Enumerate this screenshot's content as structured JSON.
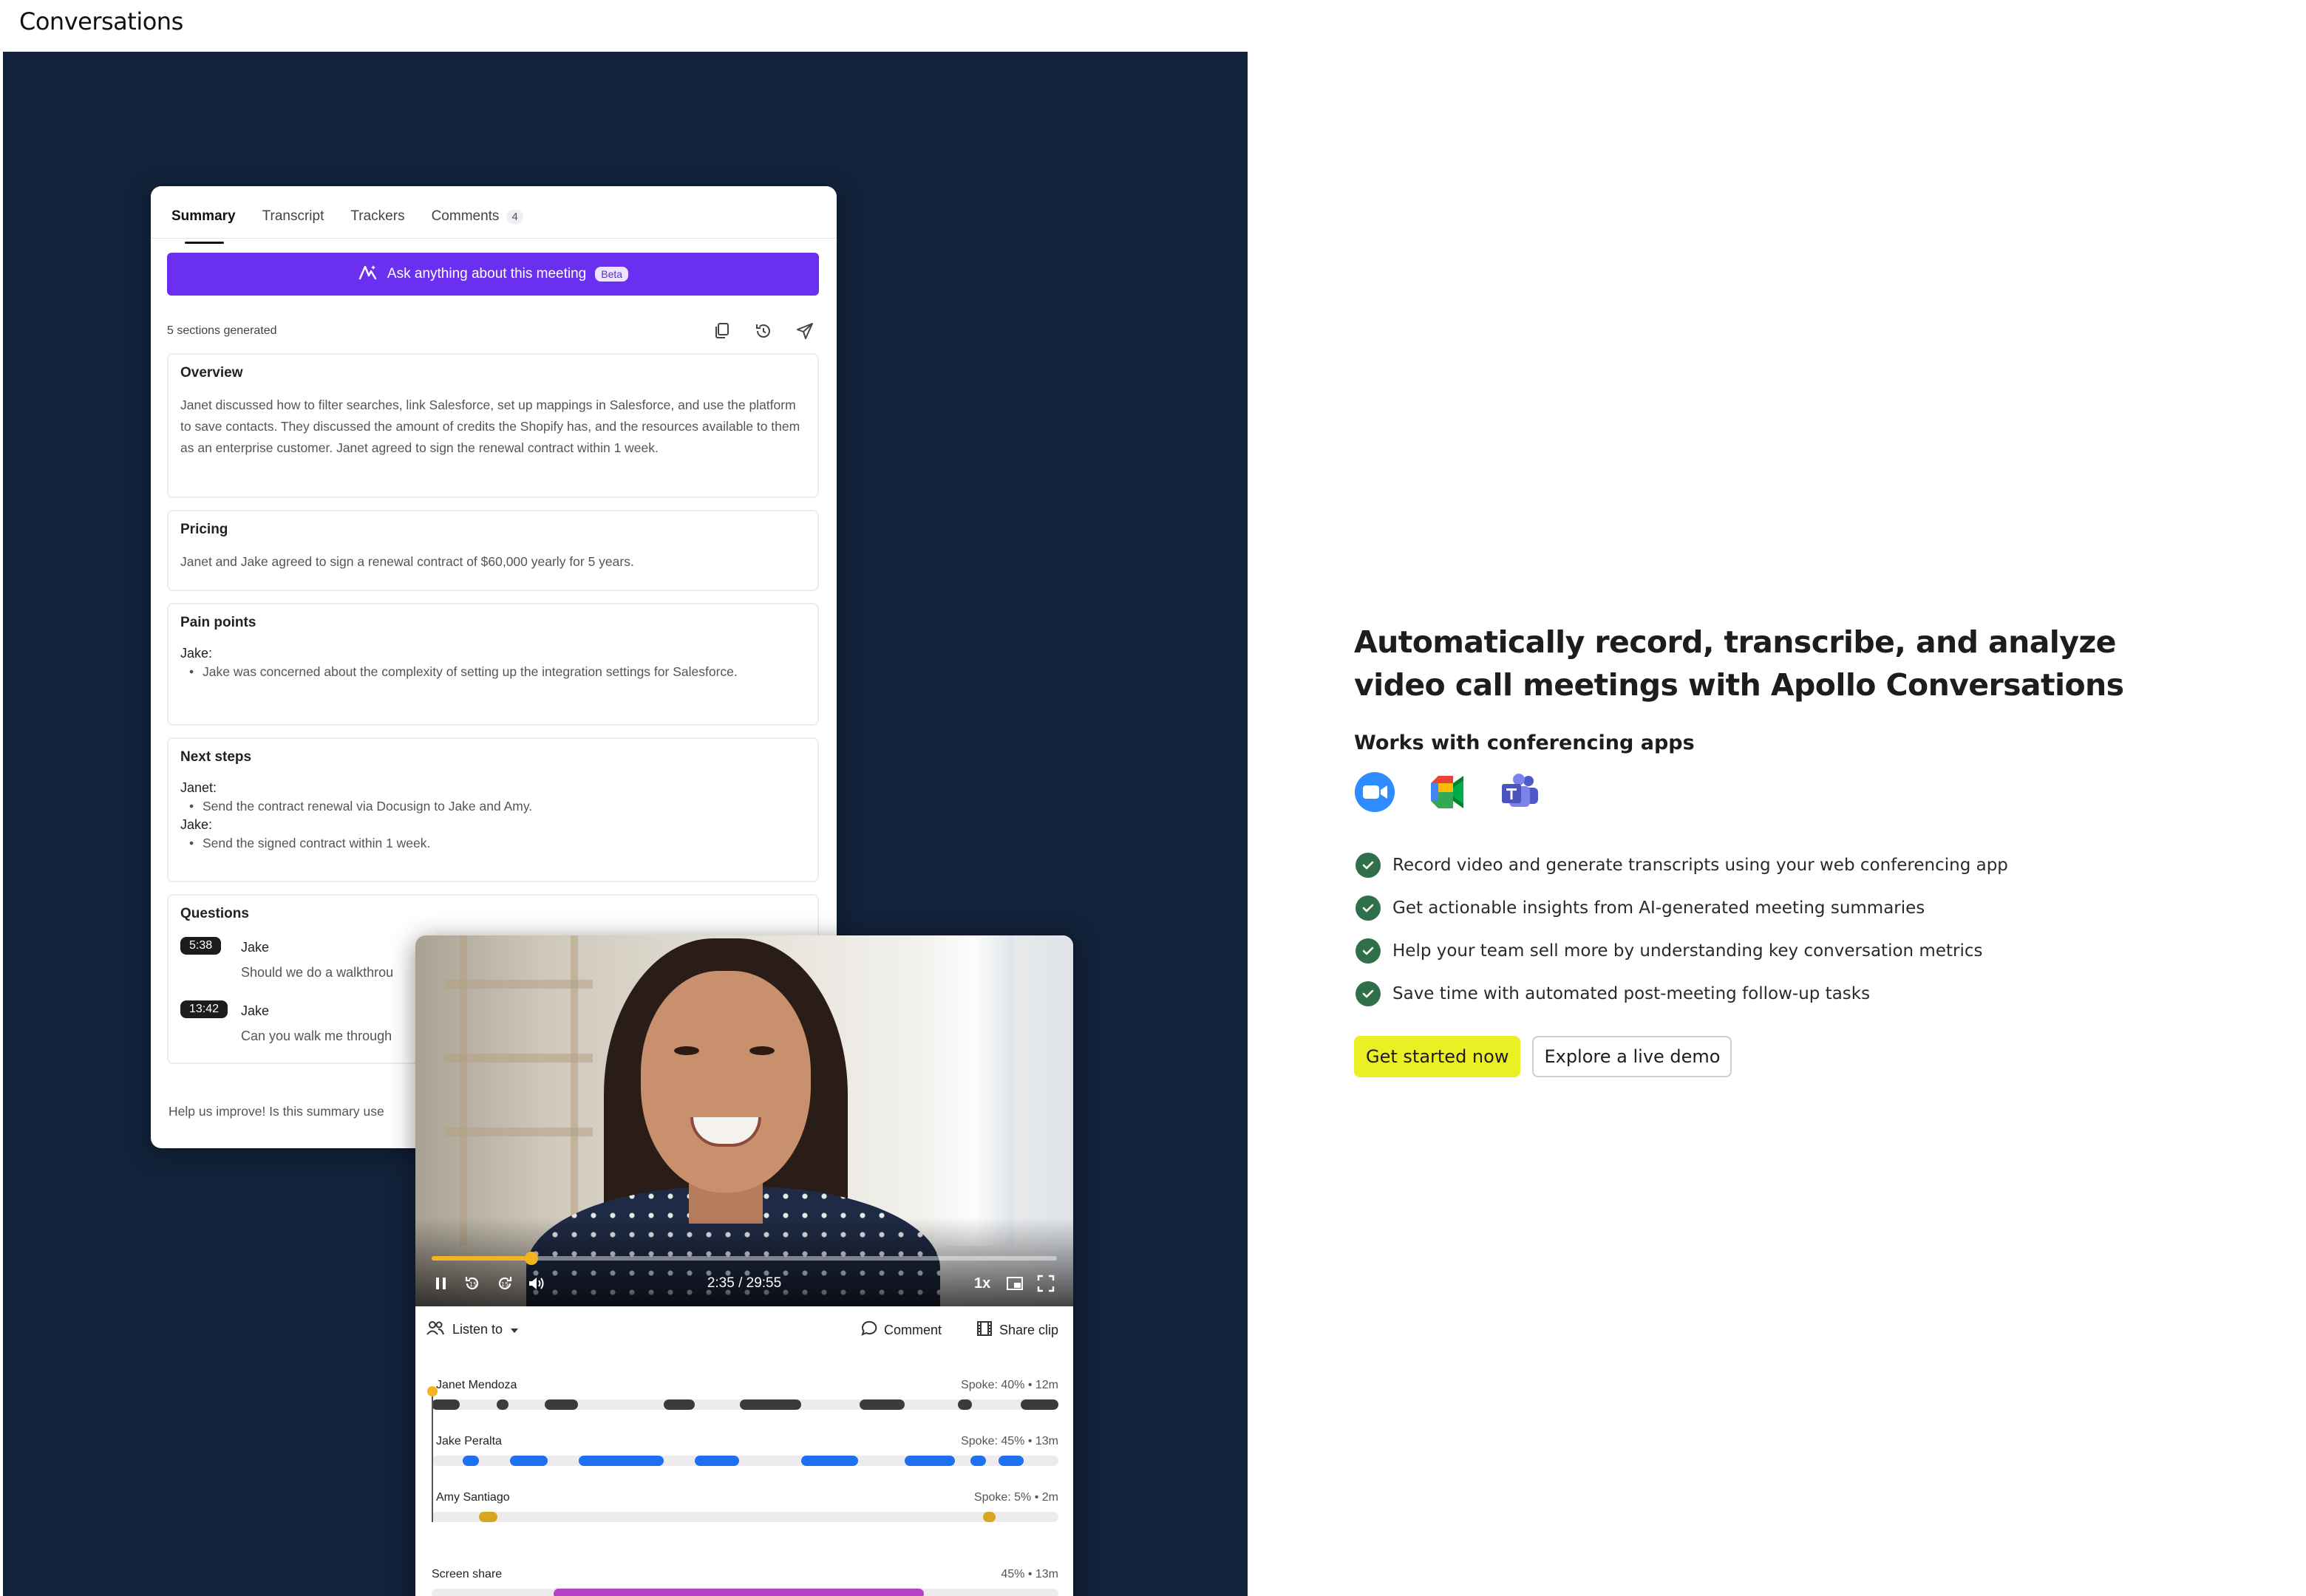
{
  "page": {
    "title": "Conversations"
  },
  "summary_card": {
    "tabs": [
      {
        "label": "Summary"
      },
      {
        "label": "Transcript"
      },
      {
        "label": "Trackers"
      },
      {
        "label": "Comments",
        "count": "4"
      }
    ],
    "ask_button": {
      "label": "Ask anything about this meeting",
      "badge": "Beta"
    },
    "sections_generated": "5 sections generated",
    "sections": {
      "overview": {
        "title": "Overview",
        "text": "Janet discussed how to filter searches, link Salesforce, set up mappings in Salesforce, and use the platform to save contacts. They discussed the amount of credits the Shopify has, and the resources available to them as an enterprise customer. Janet agreed to sign the renewal contract within 1 week."
      },
      "pricing": {
        "title": "Pricing",
        "text": "Janet and Jake agreed to sign a renewal contract of $60,000 yearly for 5 years."
      },
      "pain_points": {
        "title": "Pain points",
        "speaker": "Jake:",
        "bullet": "Jake was concerned about the complexity of setting up the integration settings for Salesforce."
      },
      "next_steps": {
        "title": "Next steps",
        "speaker1": "Janet:",
        "bullet1": "Send the contract renewal via Docusign to Jake and Amy.",
        "speaker2": "Jake:",
        "bullet2": "Send the signed contract within 1 week."
      },
      "questions": {
        "title": "Questions",
        "items": [
          {
            "time": "5:38",
            "name": "Jake",
            "text": "Should we do a walkthrou"
          },
          {
            "time": "13:42",
            "name": "Jake",
            "text": "Can you walk me through"
          }
        ]
      }
    },
    "feedback": "Help us improve! Is this summary use"
  },
  "player": {
    "time": "2:35 / 29:55",
    "speed": "1x",
    "progress_fraction": 0.16,
    "listen_to": "Listen to",
    "comment": "Comment",
    "share_clip": "Share clip",
    "speakers": [
      {
        "name": "Janet Mendoza",
        "stat": "Spoke: 40% • 12m",
        "color": "#3b3b3e"
      },
      {
        "name": "Jake Peralta",
        "stat": "Spoke: 45% • 13m",
        "color": "#1f6ff2"
      },
      {
        "name": "Amy Santiago",
        "stat": "Spoke: 5% • 2m",
        "color": "#d8a520"
      }
    ],
    "screen_share": {
      "name": "Screen share",
      "stat": "45% • 13m",
      "color": "#b640c8"
    }
  },
  "marketing": {
    "headline": "Automatically record, transcribe, and analyze video call meetings with Apollo Conversations",
    "works_with": "Works with conferencing apps",
    "apps": [
      "zoom-icon",
      "google-meet-icon",
      "microsoft-teams-icon"
    ],
    "features": [
      "Record video and generate transcripts using your web conferencing app",
      "Get actionable insights from AI-generated meeting summaries",
      "Help your team sell more by understanding key conversation metrics",
      "Save time with automated post-meeting follow-up tasks"
    ],
    "primary_cta": "Get started now",
    "secondary_cta": "Explore a live demo"
  },
  "colors": {
    "hero_bg": "#12223a",
    "ask_button": "#6b2ff0",
    "cta_yellow": "#eaf023",
    "check_green": "#2f6f4a",
    "progress": "#f2b41f"
  }
}
